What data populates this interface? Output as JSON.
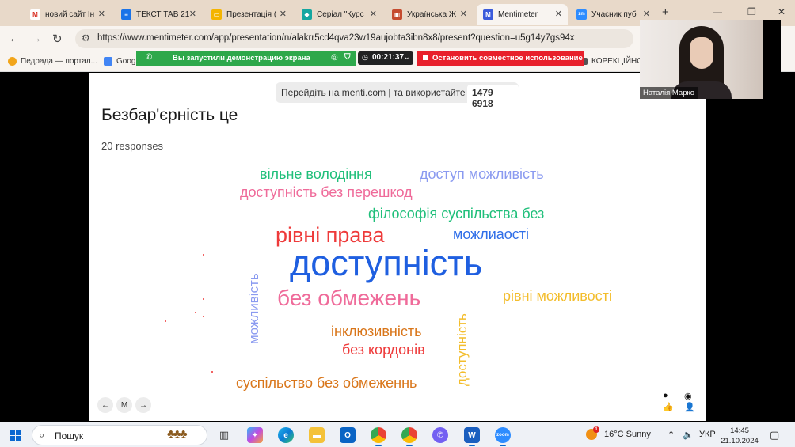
{
  "browser": {
    "tabs": [
      {
        "title": "новий сайт Ін",
        "icon": "gmail-icon",
        "color": "#d93025",
        "glyph": "M"
      },
      {
        "title": "ТЕКСТ ТАВ 21",
        "icon": "docs-icon",
        "color": "#1a73e8",
        "glyph": "≡"
      },
      {
        "title": "Презентація (",
        "icon": "slides-icon",
        "color": "#f4b400",
        "glyph": "▭"
      },
      {
        "title": "Серіал \"Курс",
        "icon": "channel-icon",
        "color": "#14a6a0",
        "glyph": "◆"
      },
      {
        "title": "Українська Ж",
        "icon": "image-icon",
        "color": "#c54b2f",
        "glyph": "▣"
      },
      {
        "title": "Mentimeter",
        "icon": "mentimeter-icon",
        "color": "#3b5bdb",
        "glyph": "M"
      },
      {
        "title": "Учасник пуб",
        "icon": "zoom-icon",
        "color": "#2d8cff",
        "glyph": "zm"
      }
    ],
    "url": "https://www.mentimeter.com/app/presentation/n/alakrr5cd4qva23w19aujobta3ibn8x8/present?question=u5g14y7gs94x",
    "bookmarks": [
      {
        "label": "Педрада — портал...",
        "color": "#f2a51a"
      },
      {
        "label": "Googl",
        "color": "#4285f4"
      },
      {
        "label": "КОРЕКЦІЙНО-",
        "color": "#555555"
      }
    ]
  },
  "share_banner": {
    "message": "Вы запустили демонстрацию экрана",
    "timer": "00:21:37",
    "stop_label": "Остановить совместное использование"
  },
  "slide": {
    "join_text": "Перейдіть на menti.com | та використайте код",
    "code": "1479 6918",
    "question": "Безбар'єрність це",
    "responses": "20 responses",
    "words": [
      {
        "text": "вільне володіння",
        "color": "#1fbf7a"
      },
      {
        "text": "доступ можливість",
        "color": "#8a9af0"
      },
      {
        "text": "доступність без перешкод",
        "color": "#ef6b9a"
      },
      {
        "text": "філософія суспільства без",
        "color": "#1fbf7a"
      },
      {
        "text": "рівні права",
        "color": "#ee3a3a"
      },
      {
        "text": "можлиаості",
        "color": "#2f6ee8"
      },
      {
        "text": "доступність",
        "color": "#1f5fe0"
      },
      {
        "text": "без обмежень",
        "color": "#ef6b9a"
      },
      {
        "text": "рівні можливості",
        "color": "#f3bd2c"
      },
      {
        "text": "можливість",
        "color": "#8a9af0"
      },
      {
        "text": "інклюзивність",
        "color": "#d9761a"
      },
      {
        "text": "без кордонів",
        "color": "#ee3a3a"
      },
      {
        "text": "доступність",
        "color": "#f3bd2c"
      },
      {
        "text": "суспільство без обмеженнь",
        "color": "#d9761a"
      }
    ]
  },
  "video": {
    "participant": "Наталія Марко"
  },
  "taskbar": {
    "search_placeholder": "Пошук",
    "weather": "16°C  Sunny",
    "weather_badge": "1",
    "language": "УКР",
    "time": "14:45",
    "date": "21.10.2024"
  }
}
